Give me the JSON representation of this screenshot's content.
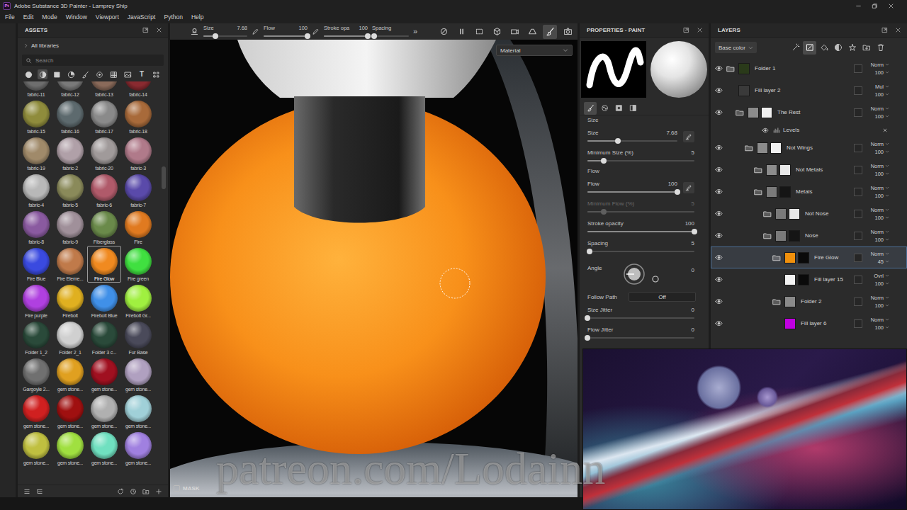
{
  "window": {
    "logo": "Pt",
    "title": "Adobe Substance 3D Painter - Lamprey Ship"
  },
  "menu": [
    "File",
    "Edit",
    "Mode",
    "Window",
    "Viewport",
    "JavaScript",
    "Python",
    "Help"
  ],
  "assets": {
    "title": "ASSETS",
    "library": "All libraries",
    "search": {
      "placeholder": "Search"
    },
    "filters": [
      {
        "kind": "materials",
        "selected": false
      },
      {
        "kind": "smart-materials",
        "selected": true
      },
      {
        "kind": "masks",
        "selected": false
      },
      {
        "kind": "procedurals",
        "selected": false
      },
      {
        "kind": "brushes",
        "selected": false
      },
      {
        "kind": "particles",
        "selected": false
      },
      {
        "kind": "textures",
        "selected": false
      },
      {
        "kind": "environments",
        "selected": false
      },
      {
        "kind": "fonts",
        "selected": false,
        "glyph": "T"
      },
      {
        "kind": "all",
        "selected": false
      }
    ],
    "items": [
      {
        "name": "fabric-11",
        "color": "#6e6e6e",
        "selected": false
      },
      {
        "name": "fabric-12",
        "color": "#7a7a7a",
        "selected": false
      },
      {
        "name": "fabric-13",
        "color": "#8a6a5a",
        "selected": false
      },
      {
        "name": "fabric-14",
        "color": "#8a2a30",
        "selected": false
      },
      {
        "name": "fabric-15",
        "color": "#8f8c3c",
        "selected": false
      },
      {
        "name": "fabric-16",
        "color": "#5d6a6e",
        "selected": false
      },
      {
        "name": "fabric-17",
        "color": "#8a8a8a",
        "selected": false
      },
      {
        "name": "fabric-18",
        "color": "#a86a3a",
        "selected": false
      },
      {
        "name": "fabric-19",
        "color": "#a08a6a",
        "selected": false
      },
      {
        "name": "fabric-2",
        "color": "#b0a0a8",
        "selected": false
      },
      {
        "name": "fabric-20",
        "color": "#a09a9a",
        "selected": false
      },
      {
        "name": "fabric-3",
        "color": "#b07a8a",
        "selected": false
      },
      {
        "name": "fabric-4",
        "color": "#b8b8b8",
        "selected": false
      },
      {
        "name": "fabric-5",
        "color": "#8a8a5a",
        "selected": false
      },
      {
        "name": "fabric-6",
        "color": "#b05a6a",
        "selected": false
      },
      {
        "name": "fabric-7",
        "color": "#5a4aaa",
        "selected": false
      },
      {
        "name": "fabric-8",
        "color": "#8a5aa0",
        "selected": false
      },
      {
        "name": "fabric-9",
        "color": "#a0909a",
        "selected": false
      },
      {
        "name": "Fiberglass",
        "color": "#6a8a4a",
        "selected": false
      },
      {
        "name": "Fire",
        "color": "#e07a20",
        "selected": false
      },
      {
        "name": "Fire Blue",
        "color": "#3a4ae0",
        "selected": false
      },
      {
        "name": "Fire Eleme...",
        "color": "#c07a4a",
        "selected": false
      },
      {
        "name": "Fire Glow",
        "color": "#f08a20",
        "selected": true
      },
      {
        "name": "Fire green",
        "color": "#40e040",
        "selected": false
      },
      {
        "name": "Fire purple",
        "color": "#b040e0",
        "selected": false
      },
      {
        "name": "Firebolt",
        "color": "#e0b020",
        "selected": false
      },
      {
        "name": "Firebolt Blue",
        "color": "#4090e8",
        "selected": false
      },
      {
        "name": "Firebolt Gr...",
        "color": "#a0f040",
        "selected": false
      },
      {
        "name": "Folder 1_2",
        "color": "#2a4a3a",
        "selected": false
      },
      {
        "name": "Folder 2_1",
        "color": "#d0d0d0",
        "selected": false
      },
      {
        "name": "Folder 3 c...",
        "color": "#2a4a3a",
        "selected": false
      },
      {
        "name": "Fur Base",
        "color": "#4a4a5a",
        "selected": false
      },
      {
        "name": "Gargoyle 2...",
        "color": "#707070",
        "selected": false
      },
      {
        "name": "gem stone...",
        "color": "#e0a020",
        "selected": false
      },
      {
        "name": "gem stone...",
        "color": "#a01020",
        "selected": false
      },
      {
        "name": "gem stone...",
        "color": "#b0a0c0",
        "selected": false
      },
      {
        "name": "gem stone...",
        "color": "#d02020",
        "selected": false
      },
      {
        "name": "gem stone...",
        "color": "#a01010",
        "selected": false
      },
      {
        "name": "gem stone...",
        "color": "#b0b0b0",
        "selected": false
      },
      {
        "name": "gem stone...",
        "color": "#a0d0d8",
        "selected": false
      },
      {
        "name": "gem stone...",
        "color": "#c0c040",
        "selected": false
      },
      {
        "name": "gem stone...",
        "color": "#a0e040",
        "selected": false
      },
      {
        "name": "gem stone...",
        "color": "#70e0c0",
        "selected": false
      },
      {
        "name": "gem stone...",
        "color": "#a080e0",
        "selected": false
      }
    ]
  },
  "toolbar": {
    "controls": [
      {
        "label": "Size",
        "value": "7.68",
        "level": 0.28,
        "pressure": true
      },
      {
        "label": "Flow",
        "value": "100",
        "level": 1,
        "pressure": true
      },
      {
        "label": "Stroke opa",
        "value": "100",
        "level": 1,
        "pressure": false
      },
      {
        "label": "Spacing",
        "level": 0.05,
        "pressure": false
      }
    ],
    "more": "»",
    "tools": [
      {
        "kind": "symmetry",
        "selected": false
      },
      {
        "kind": "pause",
        "selected": false
      },
      {
        "kind": "select",
        "selected": false
      },
      {
        "kind": "cube",
        "selected": false
      },
      {
        "kind": "camera",
        "selected": false
      },
      {
        "kind": "projection",
        "selected": false
      },
      {
        "kind": "paint",
        "selected": true
      },
      {
        "kind": "screenshot",
        "selected": false
      }
    ]
  },
  "viewport": {
    "mode": "Material",
    "mask": {
      "label": "MASK",
      "checked": false
    },
    "watermark": "patreon.com/Lodainn"
  },
  "properties": {
    "title": "PROPERTIES - PAINT",
    "tabs": [
      {
        "kind": "brush",
        "selected": true
      },
      {
        "kind": "material",
        "selected": false
      },
      {
        "kind": "alpha",
        "selected": false
      },
      {
        "kind": "stencil",
        "selected": false
      }
    ],
    "rows": [
      {
        "kind": "section",
        "label": "Size"
      },
      {
        "kind": "slider",
        "label": "Size",
        "value": "7.68",
        "level": 0.34,
        "pressure": true,
        "disabled": false
      },
      {
        "kind": "slider",
        "label": "Minimum Size (%)",
        "value": "5",
        "level": 0.15,
        "pressure": false,
        "disabled": false
      },
      {
        "kind": "section",
        "label": "Flow"
      },
      {
        "kind": "slider",
        "label": "Flow",
        "value": "100",
        "level": 1,
        "pressure": true,
        "disabled": false
      },
      {
        "kind": "slider",
        "label": "Minimum Flow (%)",
        "value": "5",
        "level": 0.15,
        "pressure": false,
        "disabled": true
      },
      {
        "kind": "slider",
        "label": "Stroke opacity",
        "value": "100",
        "level": 1,
        "pressure": false,
        "disabled": false
      },
      {
        "kind": "slider",
        "label": "Spacing",
        "value": "5",
        "level": 0.02,
        "pressure": false,
        "disabled": false
      },
      {
        "kind": "dial",
        "label": "Angle",
        "value": "0",
        "level": 0
      },
      {
        "kind": "select",
        "label": "Follow Path",
        "value": "Off"
      },
      {
        "kind": "slider",
        "label": "Size Jitter",
        "value": "0",
        "level": 0,
        "pressure": false,
        "disabled": false
      },
      {
        "kind": "slider",
        "label": "Flow Jitter",
        "value": "0",
        "level": 0,
        "pressure": false,
        "disabled": false
      }
    ]
  },
  "layers": {
    "title": "LAYERS",
    "channel": "Base color",
    "tools": [
      {
        "kind": "smart-mask",
        "selected": false
      },
      {
        "kind": "paint",
        "selected": true
      },
      {
        "kind": "fill",
        "selected": false
      },
      {
        "kind": "mask",
        "selected": false
      },
      {
        "kind": "effects",
        "selected": false
      },
      {
        "kind": "folder",
        "selected": false
      },
      {
        "kind": "trash",
        "selected": false
      }
    ],
    "rows": [
      {
        "name": "Folder 1",
        "kind": "folder",
        "depth": 0,
        "visible": true,
        "selected": false,
        "thumb": "#2a3a1a",
        "blend": "Norm",
        "opacity": "100"
      },
      {
        "name": "Fill layer 2",
        "kind": "fill",
        "depth": 0,
        "visible": true,
        "selected": false,
        "thumb": "#3a3a3a",
        "blend": "Mul",
        "opacity": "100"
      },
      {
        "name": "The Rest",
        "kind": "folder",
        "depth": 1,
        "visible": true,
        "selected": false,
        "thumb": "#8c8c8c",
        "mask": "#f0f0f0",
        "blend": "Norm",
        "opacity": "100"
      },
      {
        "name": "Levels",
        "kind": "effect",
        "depth": 2,
        "visible": true,
        "selected": false
      },
      {
        "name": "Not Wings",
        "kind": "folder",
        "depth": 2,
        "visible": true,
        "selected": false,
        "thumb": "#8c8c8c",
        "mask": "#f0f0f0",
        "blend": "Norm",
        "opacity": "100"
      },
      {
        "name": "Not Metals",
        "kind": "folder",
        "depth": 3,
        "visible": true,
        "selected": false,
        "thumb": "#8c8c8c",
        "mask": "#e8e8e8",
        "blend": "Norm",
        "opacity": "100"
      },
      {
        "name": "Metals",
        "kind": "folder",
        "depth": 3,
        "visible": true,
        "selected": false,
        "thumb": "#7a7a7a",
        "mask": "#151515",
        "blend": "Norm",
        "opacity": "100"
      },
      {
        "name": "Not Nose",
        "kind": "folder",
        "depth": 4,
        "visible": true,
        "selected": false,
        "thumb": "#7a7a7a",
        "mask": "#e8e8e8",
        "blend": "Norm",
        "opacity": "100"
      },
      {
        "name": "Nose",
        "kind": "folder",
        "depth": 4,
        "visible": true,
        "selected": false,
        "thumb": "#7a7a7a",
        "mask": "#151515",
        "blend": "Norm",
        "opacity": "100"
      },
      {
        "name": "Fire Glow",
        "kind": "folder",
        "depth": 5,
        "visible": true,
        "selected": true,
        "thumb": "#f0900c",
        "mask": "#0a0a0a",
        "blend": "Norm",
        "opacity": "45"
      },
      {
        "name": "Fill layer 15",
        "kind": "fill",
        "depth": 5,
        "visible": true,
        "selected": false,
        "thumb": "#f2f2f2",
        "mask": "#0a0a0a",
        "blend": "Ovrl",
        "opacity": "100"
      },
      {
        "name": "Folder 2",
        "kind": "folder",
        "depth": 5,
        "visible": true,
        "selected": false,
        "thumb": "#8a8a8a",
        "blend": "Norm",
        "opacity": "100"
      },
      {
        "name": "Fill layer 6",
        "kind": "fill",
        "depth": 5,
        "visible": true,
        "selected": false,
        "thumb": "#c000e0",
        "blend": "Norm",
        "opacity": "100"
      }
    ]
  }
}
